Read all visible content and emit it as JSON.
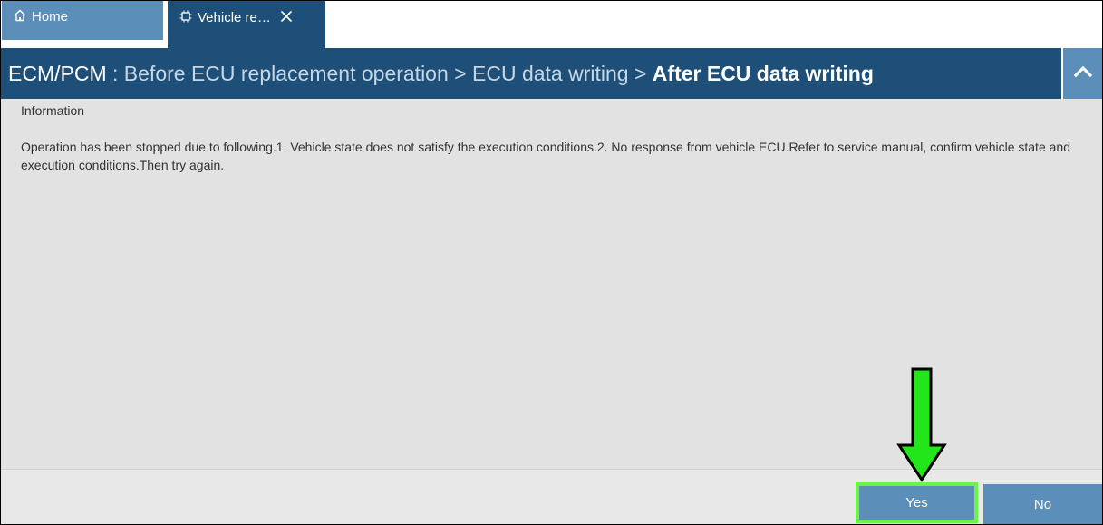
{
  "tabs": {
    "home_label": "Home",
    "home_icon": "home-icon",
    "vehicle_label": "Vehicle re…",
    "vehicle_icon": "chip-icon",
    "close_icon": "close-icon"
  },
  "header": {
    "system": "ECM/PCM",
    "system_sep": " : ",
    "crumb1": "Before ECU replacement operation",
    "crumb_sep1": " > ",
    "crumb2": "ECU data writing",
    "crumb_sep2": " > ",
    "current": "After ECU data writing",
    "collapse_icon": "chevron-up-icon"
  },
  "content": {
    "section_label": "Information",
    "message": "Operation has been stopped due to following.1. Vehicle state does not satisfy the execution conditions.2. No response from vehicle ECU.Refer to service manual, confirm vehicle state and execution conditions.Then try again."
  },
  "footer": {
    "yes_label": "Yes",
    "no_label": "No"
  },
  "colors": {
    "header_bg": "#1d4f78",
    "tab_bg": "#5b8fb9",
    "highlight": "#6cf34a",
    "content_bg": "#e2e2e2"
  }
}
